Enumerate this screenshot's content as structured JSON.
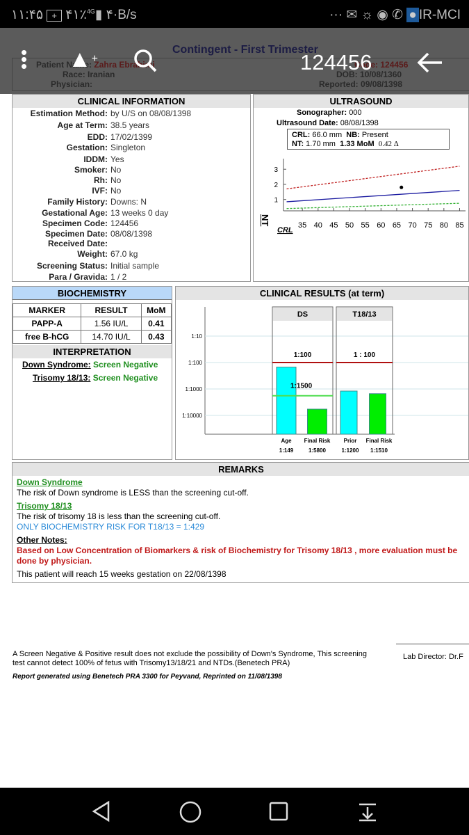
{
  "status_bar": {
    "time": "۱۱:۴۵",
    "battery": "۴۱٪",
    "network": "4G",
    "speed": "۴·B/s",
    "overflow": "···",
    "carrier": "IR-MCI"
  },
  "toolbar": {
    "title": "124456",
    "icons": [
      "more-vert-icon",
      "drive-add-icon",
      "search-icon",
      "back-arrow-icon"
    ]
  },
  "report": {
    "title": "Contingent - First Trimester",
    "patient": {
      "name_label": "Patient Name:",
      "name": "Zahra Ebrahimi",
      "race_label": "Race:",
      "race": "Iranian",
      "physician_label": "Physician:",
      "code_label": "Code:",
      "code": "124456",
      "dob_label": "DOB:",
      "dob": "10/08/1360",
      "reported_label": "Reported:",
      "reported": "09/08/1398"
    },
    "clinical": {
      "heading": "CLINICAL INFORMATION",
      "rows": [
        {
          "k": "Estimation Method:",
          "v": "by U/S on 08/08/1398"
        },
        {
          "k": "Age at Term:",
          "v": "38.5 years"
        },
        {
          "k": "EDD:",
          "v": "17/02/1399"
        },
        {
          "k": "Gestation:",
          "v": "Singleton"
        },
        {
          "k": "IDDM:",
          "v": "Yes"
        },
        {
          "k": "Smoker:",
          "v": "No"
        },
        {
          "k": "Rh:",
          "v": "No"
        },
        {
          "k": "IVF:",
          "v": "No"
        },
        {
          "k": "Family History:",
          "v": "Downs: N"
        },
        {
          "k": "Gestational Age:",
          "v": "13 weeks 0 day"
        },
        {
          "k": "Specimen Code:",
          "v": "124456"
        },
        {
          "k": "Specimen Date:",
          "v": "08/08/1398"
        },
        {
          "k": "Received Date:",
          "v": ""
        },
        {
          "k": "Weight:",
          "v": "67.0 kg"
        },
        {
          "k": "Screening Status:",
          "v": "Initial sample"
        },
        {
          "k": "Para / Gravida:",
          "v": "1 / 2"
        }
      ]
    },
    "ultrasound": {
      "heading": "ULTRASOUND",
      "sonographer_label": "Sonographer:",
      "sonographer": "000",
      "date_label": "Ultrasound Date:",
      "date": "08/08/1398",
      "crl_label": "CRL:",
      "crl": "66.0 mm",
      "nb_label": "NB:",
      "nb": "Present",
      "nt_label": "NT:",
      "nt": "1.70  mm",
      "mom": "1.33 MoM",
      "delta": "0.42 Δ"
    },
    "biochemistry": {
      "heading": "BIOCHEMISTRY",
      "columns": [
        "MARKER",
        "RESULT",
        "MoM"
      ],
      "rows": [
        [
          "PAPP-A",
          "1.56 IU/L",
          "0.41"
        ],
        [
          "free B-hCG",
          "14.70 IU/L",
          "0.43"
        ]
      ]
    },
    "interpretation": {
      "heading": "INTERPRETATION",
      "items": [
        {
          "label": "Down Syndrome:",
          "value": "Screen Negative"
        },
        {
          "label": "Trisomy 18/13:",
          "value": "Screen Negative"
        }
      ]
    },
    "clinical_results": {
      "heading": "CLINICAL RESULTS (at term)"
    },
    "remarks": {
      "heading": "REMARKS",
      "ds_title": "Down Syndrome",
      "ds_text": "The risk of Down syndrome is LESS than the screening cut-off.",
      "t_title": "Trisomy 18/13",
      "t_text": "The risk of trisomy 18 is less than the screening cut-off.",
      "t_bio": "ONLY BIOCHEMISTRY RISK FOR T18/13 = 1:429",
      "other_title": "Other Notes:",
      "other_text": "Based on Low Concentration of Biomarkers & risk of Biochemistry for Trisomy 18/13 , more evaluation must be done by physician.",
      "gestation_note": "This patient will reach 15 weeks gestation on 22/08/1398"
    },
    "footer": {
      "disclaimer": "A Screen Negative & Positive result does not exclude the possibility of Down's Syndrome, This screening test cannot detect 100% of fetus with Trisomy13/18/21 and NTDs.(Benetech PRA)",
      "generated": "Report generated using Benetech PRA 3300 for Peyvand, Reprinted on 11/08/1398",
      "director": "Lab Director: Dr.F"
    }
  },
  "chart_data": [
    {
      "type": "line",
      "ylabel": "NT",
      "xlabel": "CRL",
      "x_ticks": [
        35,
        40,
        45,
        50,
        55,
        60,
        65,
        70,
        75,
        80,
        85
      ],
      "y_ticks": [
        1,
        2,
        3
      ],
      "xlim": [
        29,
        86
      ],
      "ylim": [
        0.25,
        3.7
      ],
      "series": [
        {
          "color": "#c02020",
          "style": "dashed",
          "x": [
            30,
            85
          ],
          "y": [
            1.7,
            3.2
          ]
        },
        {
          "color": "#1a1aa0",
          "style": "solid",
          "x": [
            30,
            85
          ],
          "y": [
            0.85,
            1.6
          ]
        },
        {
          "color": "#30b030",
          "style": "dashed",
          "x": [
            30,
            85
          ],
          "y": [
            0.4,
            0.75
          ]
        }
      ],
      "points": [
        {
          "x": 66.5,
          "y": 1.8
        }
      ]
    },
    {
      "type": "bar",
      "scale": "log",
      "y_ticks": [
        "1:10",
        "1:100",
        "1:1000",
        "1:10000"
      ],
      "groups": [
        {
          "label": "DS",
          "cutoff": "1:100",
          "cutoff_value": 100,
          "second_cutoff": "1:1500",
          "second_cutoff_value": 1500,
          "bars": [
            {
              "label": "Age",
              "value_label": "1:149",
              "value": 149,
              "color": "#00ffff"
            },
            {
              "label": "Final Risk",
              "value_label": "1:5800",
              "value": 5800,
              "color": "#00ee00"
            }
          ]
        },
        {
          "label": "T18/13",
          "cutoff": "1 : 100",
          "cutoff_value": 100,
          "bars": [
            {
              "label": "Prior",
              "value_label": "1:1200",
              "value": 1200,
              "color": "#00ffff"
            },
            {
              "label": "Final Risk",
              "value_label": "1:1510",
              "value": 1510,
              "color": "#00ee00"
            }
          ]
        }
      ]
    }
  ]
}
